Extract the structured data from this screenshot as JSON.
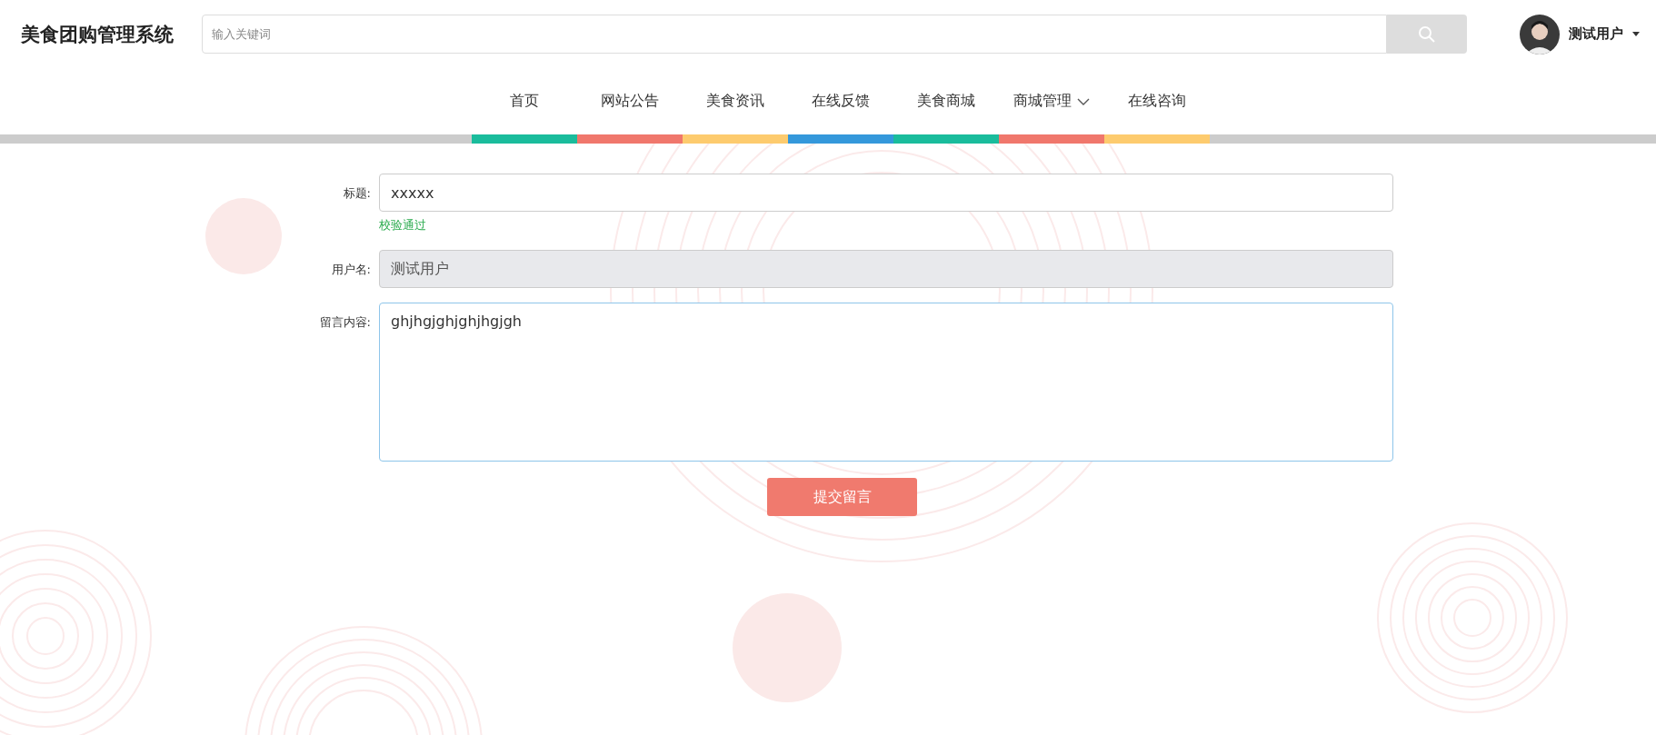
{
  "header": {
    "title": "美食团购管理系统",
    "search": {
      "placeholder": "输入关键词"
    },
    "user": {
      "name": "测试用户"
    }
  },
  "nav": [
    {
      "label": "首页",
      "kind": "link",
      "color": "#1abc9c"
    },
    {
      "label": "网站公告",
      "kind": "link",
      "color": "#f0776c"
    },
    {
      "label": "美食资讯",
      "kind": "link",
      "color": "#fdcb6e"
    },
    {
      "label": "在线反馈",
      "kind": "link",
      "color": "#3498db"
    },
    {
      "label": "美食商城",
      "kind": "link",
      "color": "#1abc9c"
    },
    {
      "label": "商城管理",
      "kind": "dropdown",
      "color": "#f0776c"
    },
    {
      "label": "在线咨询",
      "kind": "link",
      "color": "#fdcb6e"
    }
  ],
  "form": {
    "fields": [
      {
        "label": "标题:",
        "value": "xxxxx",
        "kind": "input",
        "disabled": false,
        "hint": "校验通过"
      },
      {
        "label": "用户名:",
        "value": "测试用户",
        "kind": "input",
        "disabled": true
      },
      {
        "label": "留言内容:",
        "value": "ghjhgjghjghjhgjgh",
        "kind": "textarea",
        "disabled": false
      }
    ],
    "submit": "提交留言"
  }
}
